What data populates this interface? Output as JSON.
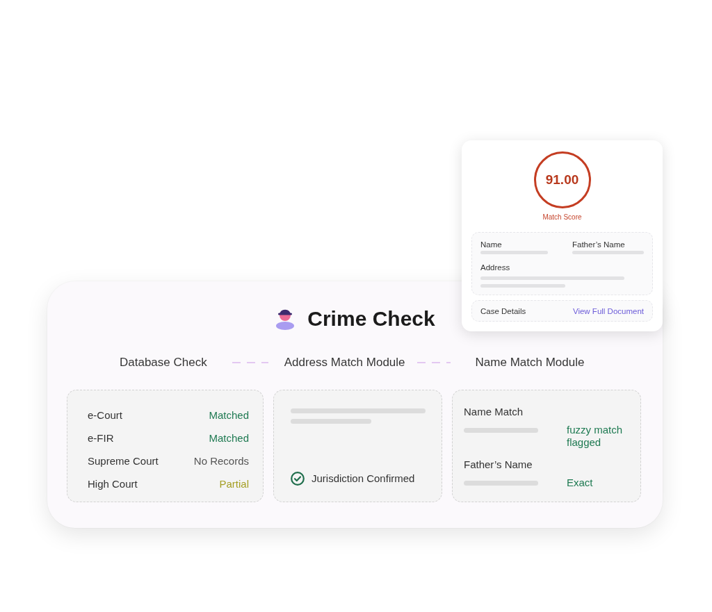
{
  "match_score_card": {
    "score": "91.00",
    "score_label": "Match Score",
    "fields": [
      "Name",
      "Father’s Name"
    ],
    "address_label": "Address",
    "case_details_label": "Case Details",
    "link": "View Full Document"
  },
  "crime_check": {
    "title": "Crime Check",
    "modules": [
      "Database Check",
      "Address Match Module",
      "Name Match Module"
    ],
    "database_check": [
      {
        "source": "e-Court",
        "result": "Matched",
        "color": "#1f7a52"
      },
      {
        "source": "e-FIR",
        "result": "Matched",
        "color": "#1f7a52"
      },
      {
        "source": "Supreme Court",
        "result": "No Records",
        "color": "#555555"
      },
      {
        "source": "High Court",
        "result": "Partial",
        "color": "#a49e22"
      }
    ],
    "address_match": {
      "status": "Jurisdiction Confirmed",
      "confirmed": true
    },
    "name_match": [
      {
        "label": "Name Match",
        "result": "fuzzy match flagged"
      },
      {
        "label": "Father’s Name",
        "result": "Exact"
      }
    ]
  }
}
